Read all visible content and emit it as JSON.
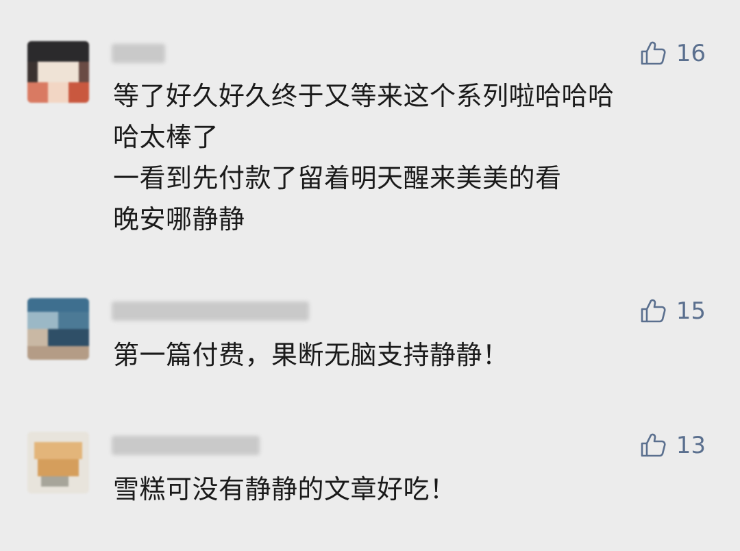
{
  "comments": [
    {
      "likes": "16",
      "lines": [
        "等了好久好久终于又等来这个系列啦哈哈哈",
        "哈太棒了",
        "一看到先付款了留着明天醒来美美的看",
        "晚安哪静静"
      ]
    },
    {
      "likes": "15",
      "lines": [
        "第一篇付费，果断无脑支持静静！"
      ]
    },
    {
      "likes": "13",
      "lines": [
        "雪糕可没有静静的文章好吃！"
      ]
    }
  ],
  "icons": {
    "like": "thumbs-up-icon"
  },
  "colors": {
    "background": "#ececec",
    "like_color": "#5a6f8e",
    "text": "#1a1a1a"
  }
}
